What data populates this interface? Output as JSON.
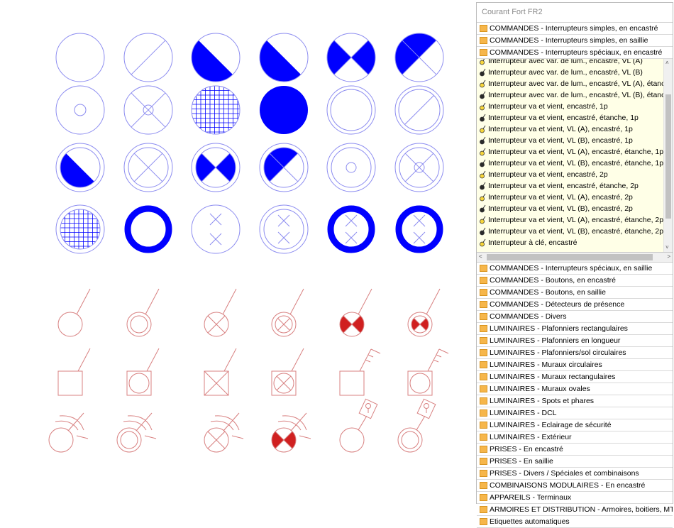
{
  "palette": {
    "title": "Courant Fort FR2",
    "categories_top": [
      "COMMANDES - Interrupteurs simples, en encastré",
      "COMMANDES - Interrupteurs simples, en saillie",
      "COMMANDES - Interrupteurs spéciaux, en encastré"
    ],
    "expanded_items": [
      "Interrupteur avec var. de lum., encastré, VL (A)",
      "Interrupteur avec var. de lum., encastré, VL (B)",
      "Interrupteur avec var. de lum., encastré, VL (A), étanche",
      "Interrupteur avec var. de lum., encastré, VL (B), étanche",
      "Interrupteur va et vient, encastré, 1p",
      "Interrupteur va et vient, encastré, étanche, 1p",
      "Interrupteur va et vient, VL (A), encastré, 1p",
      "Interrupteur va et vient, VL (B), encastré, 1p",
      "Interrupteur va et vient, VL (A), encastré, étanche, 1p",
      "Interrupteur va et vient, VL (B), encastré, étanche, 1p",
      "Interrupteur va et vient, encastré, 2p",
      "Interrupteur va et vient, encastré, étanche, 2p",
      "Interrupteur va et vient, VL (A), encastré, 2p",
      "Interrupteur va et vient, VL (B), encastré, 2p",
      "Interrupteur va et vient, VL (A), encastré, étanche, 2p",
      "Interrupteur va et vient, VL (B), encastré, étanche, 2p",
      "Interrupteur à clé, encastré"
    ],
    "categories_bottom": [
      "COMMANDES - Interrupteurs spéciaux, en saillie",
      "COMMANDES - Boutons, en encastré",
      "COMMANDES - Boutons, en saillie",
      "COMMANDES - Détecteurs de présence",
      "COMMANDES - Divers",
      "LUMINAIRES - Plafonniers rectangulaires",
      "LUMINAIRES - Plafonniers en longueur",
      "LUMINAIRES - Plafonniers/sol circulaires",
      "LUMINAIRES - Muraux circulaires",
      "LUMINAIRES - Muraux rectangulaires",
      "LUMINAIRES - Muraux ovales",
      "LUMINAIRES - Spots et phares",
      "LUMINAIRES - DCL",
      "LUMINAIRES - Eclairage de sécurité",
      "LUMINAIRES - Extérieur",
      "PRISES - En encastré",
      "PRISES - En saillie",
      "PRISES - Divers / Spéciales et combinaisons",
      "COMBINAISONS MODULAIRES - En encastré",
      "APPAREILS - Terminaux",
      "ARMOIRES ET DISTRIBUTION - Armoires, boitiers, MT/B...",
      "Etiquettes automatiques"
    ],
    "scroll_up_glyph": "˄",
    "scroll_down_glyph": "˅",
    "scroll_left_glyph": "<",
    "scroll_right_glyph": ">"
  },
  "colors": {
    "blue_symbol": "#0000ff",
    "blue_outline": "#8c8cf0",
    "red_symbol": "#d02020",
    "red_outline": "#d88080",
    "folder": "#f6b64a",
    "expanded_bg": "#ffffe7"
  },
  "symbol_icons": [
    "empty-circle-icon",
    "diagonal-circle-icon",
    "half-filled-circle-icon",
    "half-filled-circle-icon",
    "bowtie-circle-icon",
    "triangle-circle-icon",
    "center-dot-circle-icon",
    "x-small-circle-icon",
    "grid-circle-icon",
    "filled-circle-icon",
    "double-circle-icon",
    "double-diagonal-circle-icon",
    "double-half-filled-circle-icon",
    "double-x-circle-icon",
    "double-bowtie-circle-icon",
    "double-triangle-circle-icon",
    "double-dot-circle-icon",
    "double-x-dot-circle-icon",
    "double-grid-circle-icon",
    "thick-ring-icon",
    "double-x-pair-circle-icon",
    "double-x-pair-circle-icon",
    "thick-ring-x-icon",
    "thick-ring-x-icon",
    "switch-circle-icon",
    "switch-double-circle-icon",
    "switch-x-circle-icon",
    "switch-double-x-circle-icon",
    "switch-red-bowtie-icon",
    "switch-double-red-bowtie-icon",
    "switch-square-icon",
    "switch-square-circle-icon",
    "switch-square-x-icon",
    "switch-square-circle-x-icon",
    "key-switch-square-icon",
    "key-switch-square-circle-icon",
    "timer-circle-icon",
    "timer-double-circle-icon",
    "timer-x-circle-icon",
    "timer-red-bowtie-icon",
    "key-lock-circle-icon",
    "key-lock-double-circle-icon"
  ]
}
